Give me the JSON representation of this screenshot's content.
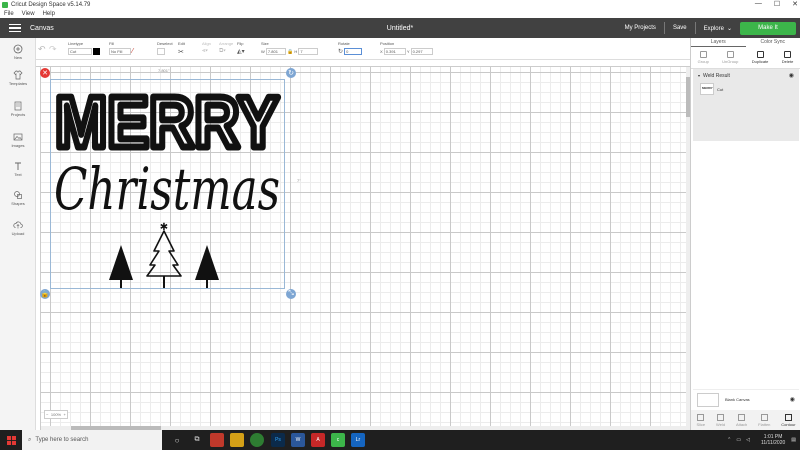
{
  "window": {
    "title": "Cricut Design Space  v5.14.79",
    "controls": [
      "—",
      "☐",
      "✕"
    ],
    "menu": [
      "File",
      "View",
      "Help"
    ]
  },
  "header": {
    "section": "Canvas",
    "document_title": "Untitled*",
    "my_projects": "My Projects",
    "save": "Save",
    "explore": "Explore",
    "make_it": "Make It",
    "accent": "#3cb54a",
    "bar_color": "#414141"
  },
  "toolbar": {
    "undo_icon": "undo-icon",
    "redo_icon": "redo-icon",
    "linetype_label": "Linetype",
    "linetype_value": "Cut",
    "fill_label": "Fill",
    "fill_value": "No Fill",
    "deselect_label": "Deselect",
    "edit_label": "Edit",
    "align_label": "Align",
    "arrange_label": "Arrange",
    "flip_label": "Flip",
    "size_label": "Size",
    "size_w_prefix": "W",
    "size_w": "7.801",
    "size_h_prefix": "H",
    "size_h": "7",
    "rotate_label": "Rotate",
    "rotate_value": "0",
    "position_label": "Position",
    "pos_x_prefix": "X",
    "pos_x": "0.391",
    "pos_y_prefix": "Y",
    "pos_y": "0.297"
  },
  "sidebar": {
    "items": [
      {
        "label": "New",
        "icon": "plus-icon"
      },
      {
        "label": "Templates",
        "icon": "shirt-icon"
      },
      {
        "label": "Projects",
        "icon": "projects-icon"
      },
      {
        "label": "Images",
        "icon": "image-icon"
      },
      {
        "label": "Text",
        "icon": "text-icon"
      },
      {
        "label": "Shapes",
        "icon": "shapes-icon"
      },
      {
        "label": "Upload",
        "icon": "upload-icon"
      }
    ]
  },
  "canvas": {
    "size_readout": "7.801\"",
    "size_readout_h": "7\"",
    "design_text_line1": "MERRY",
    "design_text_line2": "Christmas",
    "zoom_label": "100%",
    "selection_color": "#9ab8d6",
    "delete_color": "#e53935",
    "handle_color": "#7ea6d3"
  },
  "panel": {
    "tabs": [
      "Layers",
      "Color Sync"
    ],
    "actions": [
      "Group",
      "UnGroup",
      "Duplicate",
      "Delete"
    ],
    "group_name": "Weld Result",
    "layer_type": "Cut",
    "thumb_text": "MERRY",
    "blank_canvas": "Blank Canvas",
    "bottom_actions": [
      "Slice",
      "Weld",
      "Attach",
      "Flatten",
      "Contour"
    ]
  },
  "taskbar": {
    "search_placeholder": "Type here to search",
    "time": "1:01 PM",
    "date": "11/11/2020"
  }
}
